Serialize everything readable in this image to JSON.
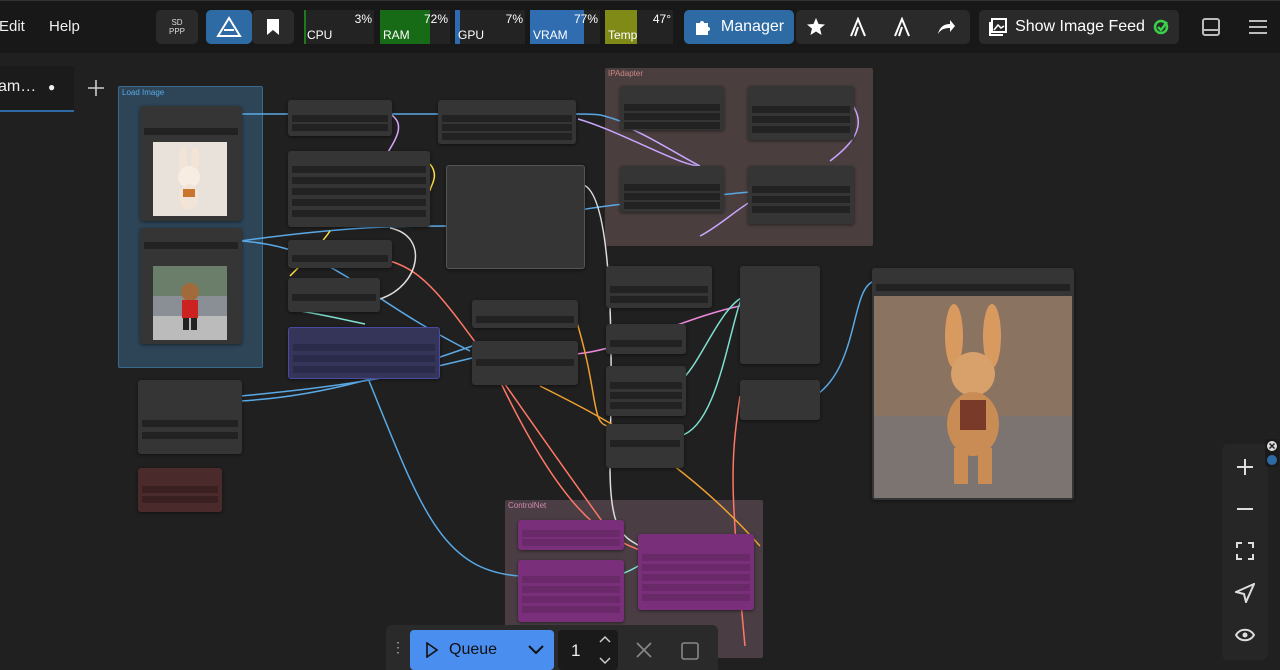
{
  "menu": {
    "edit": "Edit",
    "help": "Help"
  },
  "toolbar": {
    "sd_line1": "SD",
    "sd_line2": "PPP",
    "manager_label": "Manager",
    "image_feed_label": "Show Image Feed"
  },
  "monitors": [
    {
      "label": "CPU",
      "value_text": "3%",
      "level": 0.03,
      "color": "#1f7a1f"
    },
    {
      "label": "RAM",
      "value_text": "72%",
      "level": 0.72,
      "color": "#176b17"
    },
    {
      "label": "GPU",
      "value_text": "7%",
      "level": 0.07,
      "color": "#2e6ab0"
    },
    {
      "label": "VRAM",
      "value_text": "77%",
      "level": 0.77,
      "color": "#2f6db0"
    },
    {
      "label": "Temp",
      "value_text": "47°",
      "level": 0.47,
      "color": "#7f8a17"
    }
  ],
  "tab": {
    "title": "am…",
    "modified_dot": "●"
  },
  "groups": {
    "load_image": "Load Image",
    "ipadapter": "IPAdapter",
    "controlnet": "ControlNet"
  },
  "queue": {
    "label": "Queue",
    "count": "1"
  },
  "colors": {
    "accent_blue": "#2e6aa3",
    "queue_blue": "#4a8ff0",
    "node_bg": "#353535",
    "canvas_bg": "#202020",
    "controlnet_node": "#7a2f7a"
  },
  "icons": [
    "logo-icon",
    "bookmark-icon",
    "puzzle-icon",
    "star-icon",
    "sigma-icon",
    "forward-icon",
    "image-icon",
    "panel-icon",
    "hamburger-icon",
    "plus-icon",
    "minus-icon",
    "fit-icon",
    "navigate-icon",
    "eye-icon",
    "play-icon",
    "chevron-down-icon",
    "close-icon",
    "stop-icon"
  ]
}
